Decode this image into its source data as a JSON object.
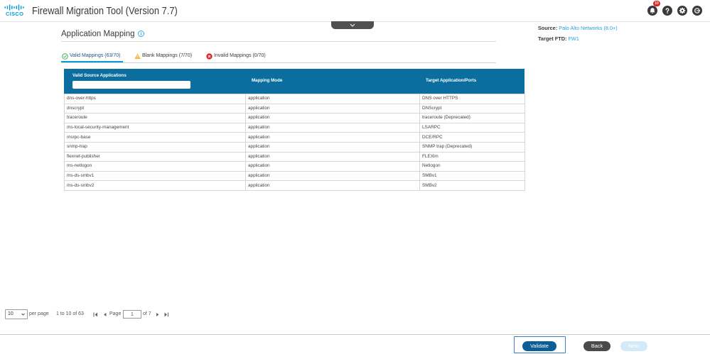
{
  "header": {
    "logo_text": "CISCO",
    "title": "Firewall Migration Tool (Version 7.7)",
    "notification_count": "10",
    "icons": [
      "bell-icon",
      "help-icon",
      "gear-icon",
      "logout-icon"
    ]
  },
  "migration_info": {
    "source_label": "Source:",
    "source_value": "Palo Alto Networks (8.0+)",
    "target_label": "Target FTD:",
    "target_value": "FW1"
  },
  "page": {
    "title": "Application Mapping",
    "title_icon": "info-icon"
  },
  "tabs": [
    {
      "label": "Valid Mappings (63/70)",
      "icon": "check-circle-icon",
      "active": true
    },
    {
      "label": "Blank Mappings (7/70)",
      "icon": "warning-icon",
      "active": false
    },
    {
      "label": "Invalid Mappings (0/70)",
      "icon": "error-icon",
      "active": false
    }
  ],
  "table": {
    "columns": {
      "source": "Valid Source Applications",
      "mode": "Mapping Mode",
      "target": "Target Application/Ports"
    },
    "rows": [
      {
        "source": "dns-over-https",
        "mode": "application",
        "target": "DNS over HTTPS"
      },
      {
        "source": "dnscrypt",
        "mode": "application",
        "target": "DNScrypt"
      },
      {
        "source": "traceroute",
        "mode": "application",
        "target": "traceroute (Deprecated)"
      },
      {
        "source": "ms-local-security-management",
        "mode": "application",
        "target": "LSARPC"
      },
      {
        "source": "msrpc-base",
        "mode": "application",
        "target": "DCE/RPC"
      },
      {
        "source": "snmp-trap",
        "mode": "application",
        "target": "SNMP trap (Deprecated)"
      },
      {
        "source": "flexnet-publisher",
        "mode": "application",
        "target": "FLEXlm"
      },
      {
        "source": "ms-netlogon",
        "mode": "application",
        "target": "Netlogon"
      },
      {
        "source": "ms-ds-smbv1",
        "mode": "application",
        "target": "SMBv1"
      },
      {
        "source": "ms-ds-smbv2",
        "mode": "application",
        "target": "SMBv2"
      }
    ]
  },
  "pagination": {
    "per_page": "10",
    "per_page_label": "per page",
    "range": "1 to 10 of 63",
    "page_label": "Page",
    "current_page": "1",
    "total_pages_label": "of 7"
  },
  "footer": {
    "validate_label": "Validate",
    "back_label": "Back",
    "next_label": "Next",
    "next_disabled": true
  },
  "colors": {
    "brand": "#049fd9",
    "table_header": "#0b6e9f",
    "primary_button": "#0b5f93",
    "secondary_button": "#4a4a4a",
    "disabled_button": "#d3eaf8",
    "focus_ring": "#3a80d2",
    "notification_badge": "#e2231a",
    "success": "#3aa757",
    "warning": "#f5b82e",
    "error": "#e0282e"
  }
}
